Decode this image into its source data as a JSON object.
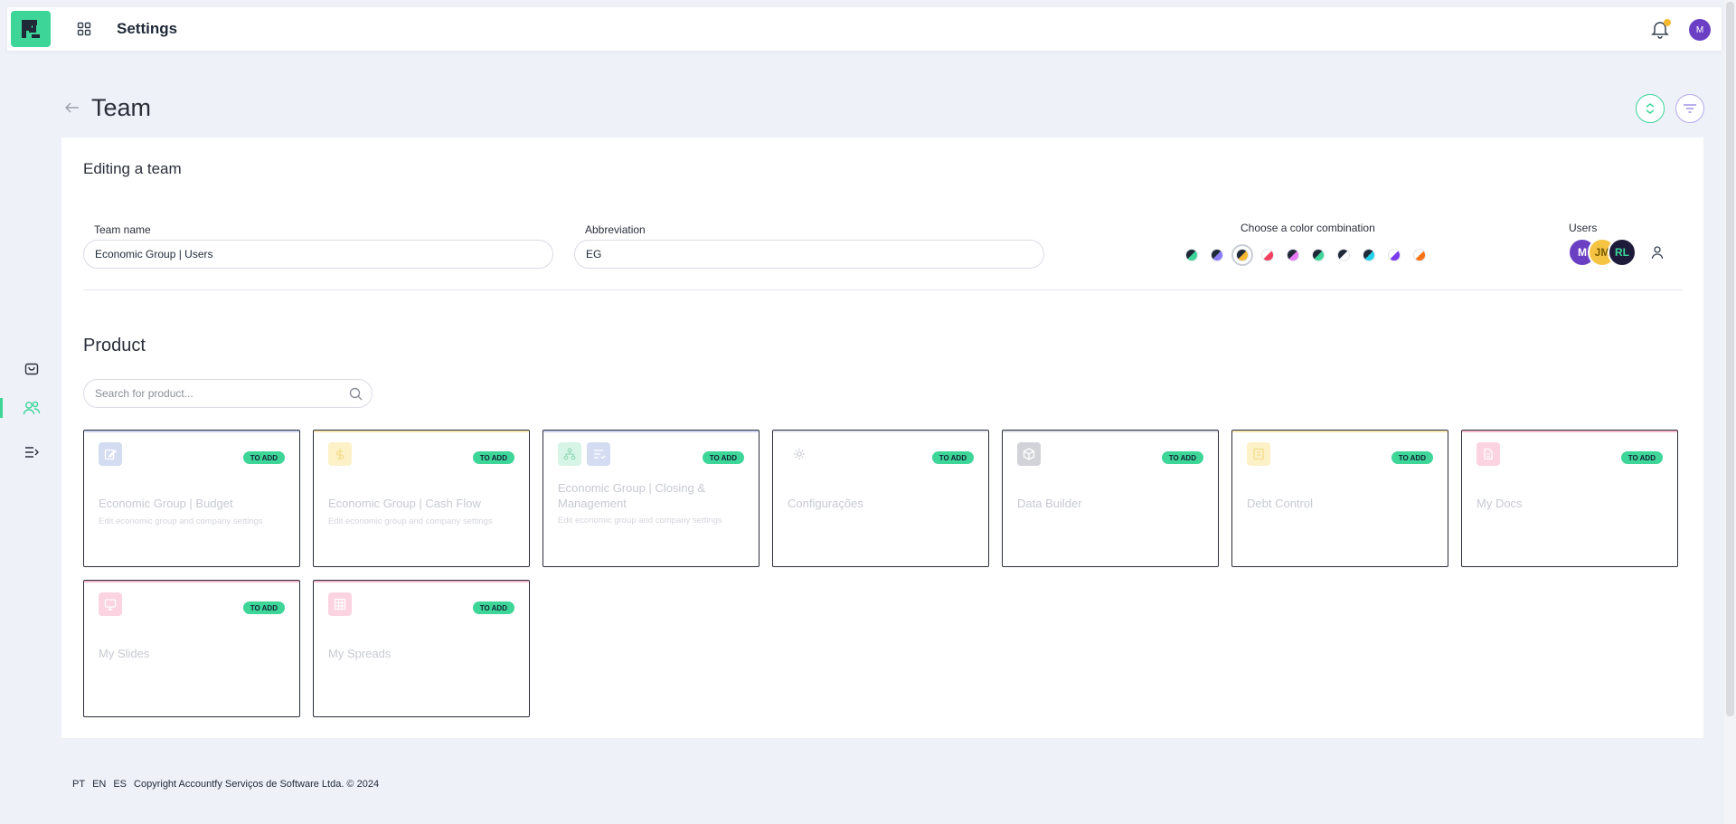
{
  "topbar": {
    "title": "Settings",
    "avatar_initial": "M"
  },
  "page": {
    "title": "Team"
  },
  "form": {
    "subtitle": "Editing a team",
    "team_name_label": "Team name",
    "team_name_value": "Economic Group | Users",
    "abbreviation_label": "Abbreviation",
    "abbreviation_value": "EG",
    "color_label": "Choose a color combination",
    "users_label": "Users",
    "colors": [
      {
        "a": "#1f2937",
        "b": "#3dd598"
      },
      {
        "a": "#1f2937",
        "b": "#8b7cf6"
      },
      {
        "a": "#1f2937",
        "b": "#f5b82e"
      },
      {
        "a": "#ffffff",
        "b": "#f43f5e"
      },
      {
        "a": "#1f2937",
        "b": "#e879f9"
      },
      {
        "a": "#1f2937",
        "b": "#3dd598"
      },
      {
        "a": "#1f2937",
        "b": "#ffffff"
      },
      {
        "a": "#1f2937",
        "b": "#22d3ee"
      },
      {
        "a": "#ffffff",
        "b": "#7c3aed"
      },
      {
        "a": "#ffffff",
        "b": "#f97316"
      }
    ],
    "selected_color_index": 2,
    "users": [
      {
        "initials": "M",
        "bg": "#6b3fc4",
        "fg": "#ffffff"
      },
      {
        "initials": "JM",
        "bg": "#f5c443",
        "fg": "#7a5a00"
      },
      {
        "initials": "RL",
        "bg": "#1e1b3a",
        "fg": "#3dd598"
      }
    ]
  },
  "product": {
    "title": "Product",
    "search_placeholder": "Search for product...",
    "badge_label": "TO ADD",
    "cards": [
      {
        "title": "Economic Group | Budget",
        "desc": "Edit economic group and company settings",
        "icon": "edit-icon",
        "icon_bg": "#d4dcf2",
        "topline": "#c9d2ef"
      },
      {
        "title": "Economic Group | Cash Flow",
        "desc": "Edit economic group and company settings",
        "icon": "dollar-icon",
        "icon_bg": "#fdf1c8",
        "topline": "#f5e7b3"
      },
      {
        "title": "Economic Group | Closing & Management",
        "desc": "Edit economic group and company settings",
        "icon": "hierarchy-icon",
        "icon_bg": "#d6f5e6",
        "icon2": "checklist-icon",
        "icon2_bg": "#d4dcf2",
        "topline": "#c9d2ef"
      },
      {
        "title": "Configurações",
        "desc": "",
        "icon": "gear-icon",
        "icon_bg": "#ffffff",
        "topline": "#e5e7eb"
      },
      {
        "title": "Data Builder",
        "desc": "",
        "icon": "cube-icon",
        "icon_bg": "#d1d3d8",
        "topline": "#d9dbe0"
      },
      {
        "title": "Debt Control",
        "desc": "",
        "icon": "ledger-icon",
        "icon_bg": "#fdf1c8",
        "topline": "#f5e7b3"
      },
      {
        "title": "My Docs",
        "desc": "",
        "icon": "document-icon",
        "icon_bg": "#fcd3e1",
        "topline": "#f6b6cc"
      },
      {
        "title": "My Slides",
        "desc": "",
        "icon": "presentation-icon",
        "icon_bg": "#fcd3e1",
        "topline": "#f6b6cc"
      },
      {
        "title": "My Spreads",
        "desc": "",
        "icon": "grid-icon",
        "icon_bg": "#fcd3e1",
        "topline": "#f6b6cc"
      }
    ]
  },
  "footer": {
    "langs": [
      "PT",
      "EN",
      "ES"
    ],
    "copyright": "Copyright Accountfy Serviços de Software Ltda. © 2024"
  }
}
